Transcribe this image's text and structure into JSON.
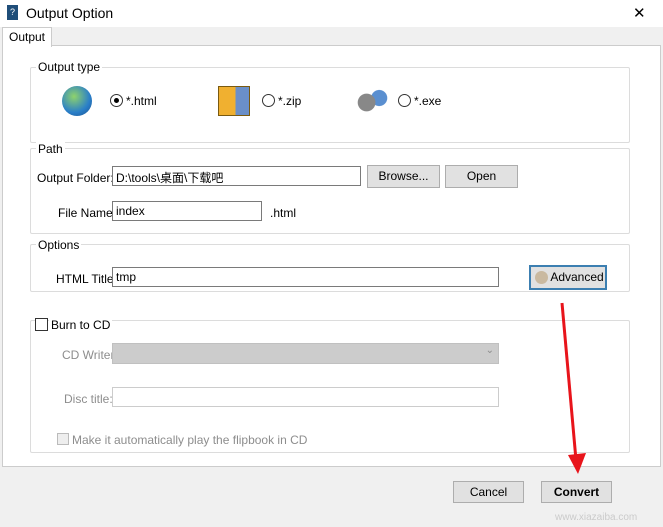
{
  "window": {
    "title": "Output Option",
    "close": "✕"
  },
  "tabs": [
    {
      "label": "Output",
      "active": true
    }
  ],
  "output_type": {
    "label": "Output type",
    "options": [
      {
        "label": "*.html",
        "selected": true
      },
      {
        "label": "*.zip",
        "selected": false
      },
      {
        "label": "*.exe",
        "selected": false
      }
    ]
  },
  "path": {
    "label": "Path",
    "folder_label": "Output Folder:",
    "folder_value": "D:\\tools\\桌面\\下载吧",
    "browse": "Browse...",
    "open": "Open",
    "file_label": "File Name:",
    "file_value": "index",
    "ext": ".html"
  },
  "options": {
    "label": "Options",
    "title_label": "HTML Title:",
    "title_value": "tmp",
    "advanced": "Advanced"
  },
  "burn": {
    "label": "Burn to CD",
    "checked": false,
    "writer_label": "CD Writer",
    "writer_value": "",
    "disc_label": "Disc title:",
    "disc_value": "",
    "autoplay_label": "Make it automatically play the flipbook in CD",
    "autoplay_checked": false
  },
  "footer": {
    "cancel": "Cancel",
    "convert": "Convert"
  },
  "annotation_color": "#e8141b",
  "watermark": "www.xiazaiba.com"
}
